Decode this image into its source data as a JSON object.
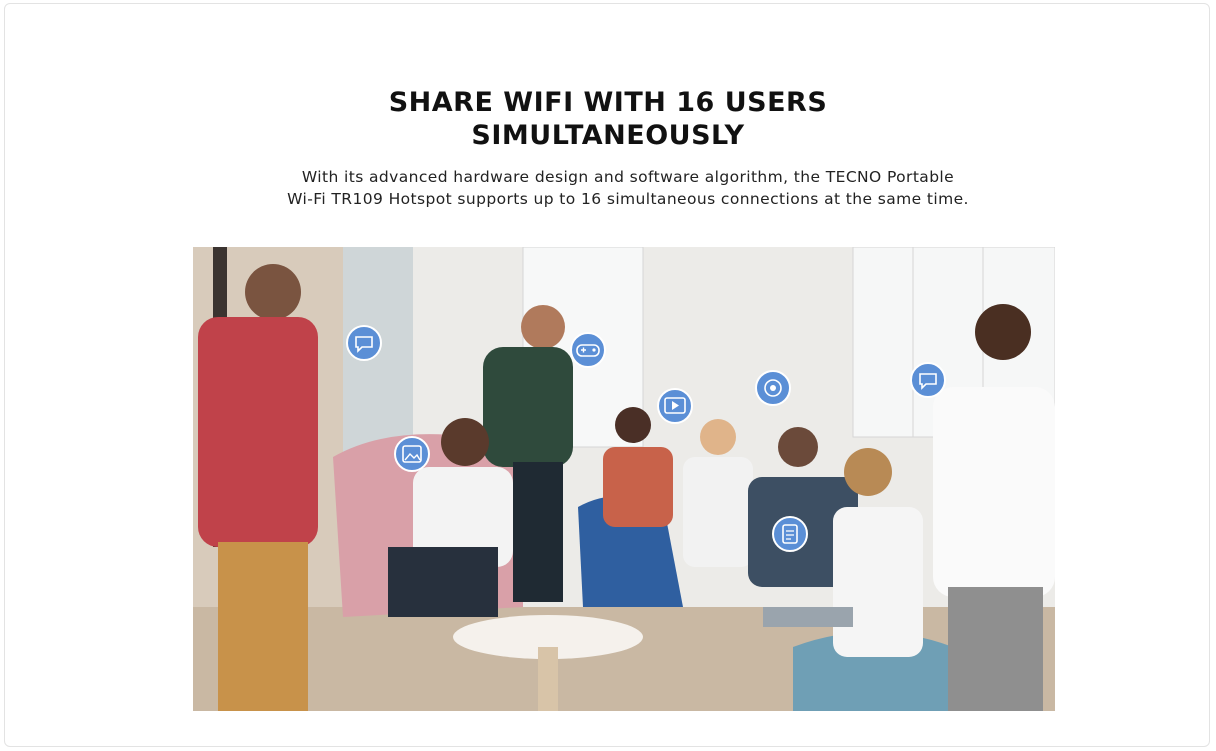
{
  "heading": {
    "line1": "SHARE WIFI WITH 16 USERS",
    "line2": "SIMULTANEOUSLY"
  },
  "description": {
    "line1": "With its advanced hardware design and software algorithm, the TECNO Portable",
    "line2": "Wi-Fi TR109 Hotspot supports up to 16 simultaneous connections at the same time."
  },
  "colors": {
    "bubble": "#5b8fd6",
    "wall": "#ecebe8",
    "floor": "#c9b8a3",
    "pink_chair": "#d9a0a8",
    "blue_chair": "#2f5fa0"
  },
  "app_bubbles": [
    {
      "icon": "chat-icon"
    },
    {
      "icon": "gamepad-icon"
    },
    {
      "icon": "play-video-icon"
    },
    {
      "icon": "camera-icon"
    },
    {
      "icon": "chat-icon"
    },
    {
      "icon": "photo-edit-icon"
    },
    {
      "icon": "document-icon"
    }
  ]
}
